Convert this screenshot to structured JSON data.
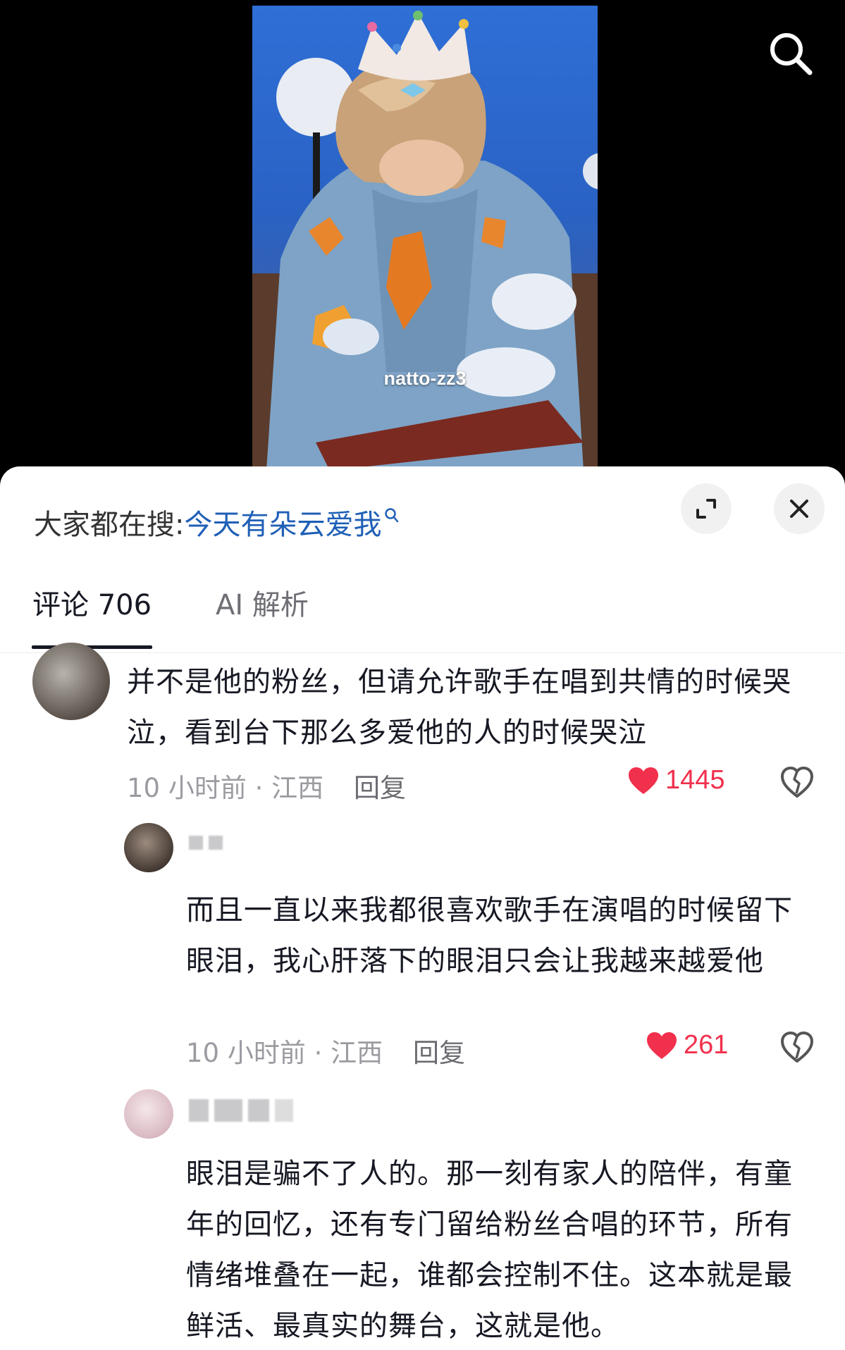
{
  "video": {
    "watermark": "natto-zz3",
    "search_icon": "search-icon"
  },
  "sheet": {
    "hot_search_prefix": "大家都在搜:",
    "hot_search_term": "今天有朵云爱我",
    "expand_icon": "expand-icon",
    "close_icon": "close-icon"
  },
  "tabs": [
    {
      "label": "评论 706",
      "active": true
    },
    {
      "label": "AI 解析",
      "active": false
    }
  ],
  "comments": [
    {
      "text": "并不是他的粉丝，但请允许歌手在唱到共情的时候哭泣，看到台下那么多爱他的人的时候哭泣",
      "meta": "10 小时前 · 江西",
      "reply_label": "回复",
      "likes": "1445",
      "liked": true
    },
    {
      "text": "而且一直以来我都很喜欢歌手在演唱的时候留下眼泪，我心肝落下的眼泪只会让我越来越爱他",
      "meta": "10 小时前 · 江西",
      "reply_label": "回复",
      "likes": "261",
      "liked": true
    },
    {
      "text": "眼泪是骗不了人的。那一刻有家人的陪伴，有童年的回忆，还有专门留给粉丝合唱的环节，所有情绪堆叠在一起，谁都会控制不住。这本就是最鲜活、最真实的舞台，这就是他。"
    }
  ],
  "colors": {
    "accent_blue": "#1f5fb6",
    "like_red": "#f1304d",
    "text_main": "#161823",
    "text_meta": "#9b9ba1"
  }
}
